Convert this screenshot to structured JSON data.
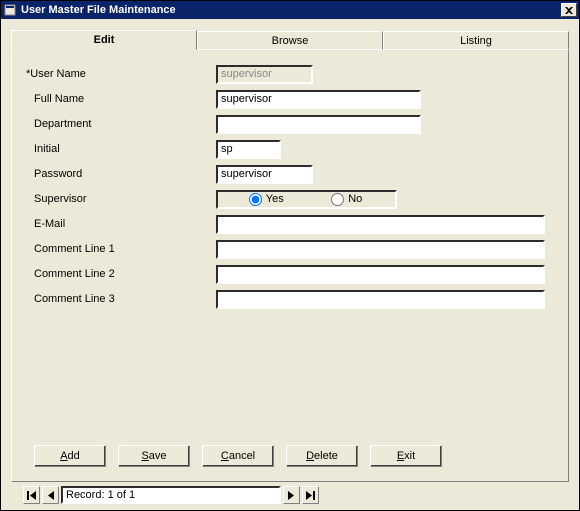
{
  "window": {
    "title": "User Master File Maintenance"
  },
  "tabs": {
    "edit": "Edit",
    "browse": "Browse",
    "listing": "Listing"
  },
  "labels": {
    "user_name": "*User Name",
    "full_name": "Full Name",
    "department": "Department",
    "initial": "Initial",
    "password": "Password",
    "supervisor": "Supervisor",
    "email": "E-Mail",
    "comment1": "Comment Line 1",
    "comment2": "Comment Line 2",
    "comment3": "Comment Line 3"
  },
  "fields": {
    "user_name": "supervisor",
    "full_name": "supervisor",
    "department": "",
    "initial": "sp",
    "password": "supervisor",
    "supervisor_yes": "Yes",
    "supervisor_no": "No",
    "email": "",
    "comment1": "",
    "comment2": "",
    "comment3": ""
  },
  "buttons": {
    "add": "dd",
    "add_u": "A",
    "save": "ave",
    "save_u": "S",
    "cancel": "ancel",
    "cancel_u": "C",
    "delete": "elete",
    "delete_u": "D",
    "exit": "xit",
    "exit_u": "E"
  },
  "nav": {
    "record": "Record: 1 of 1"
  }
}
